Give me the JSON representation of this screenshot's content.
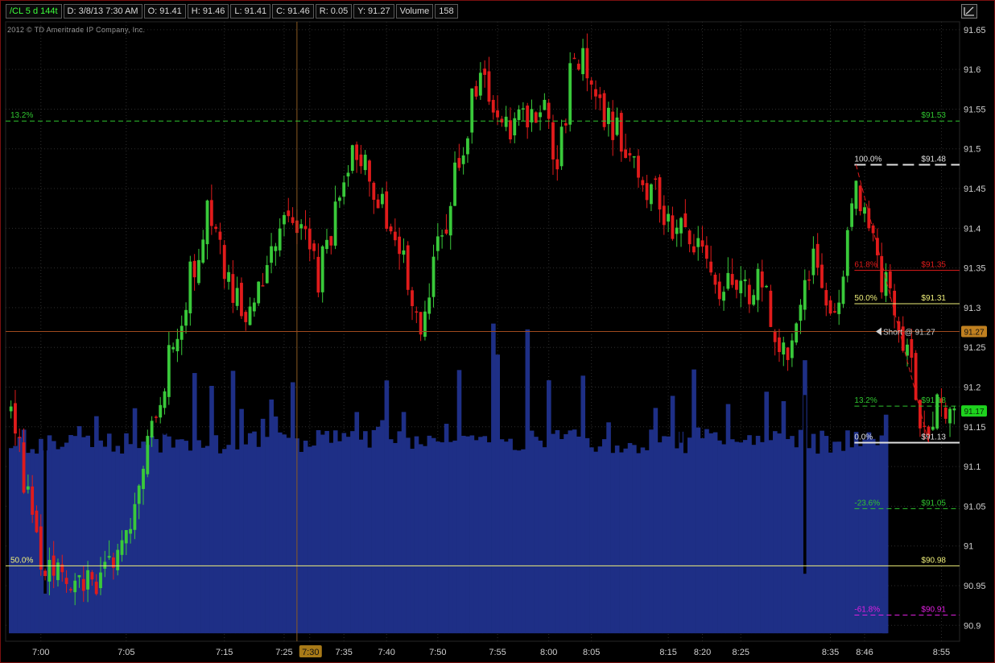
{
  "header": {
    "symbol": "/CL 5 d 144t",
    "date": "D: 3/8/13 7:30 AM",
    "open": "O: 91.41",
    "high": "H: 91.46",
    "low": "L: 91.41",
    "close": "C: 91.46",
    "range": "R: 0.05",
    "y": "Y: 91.27",
    "volume_label": "Volume",
    "volume_value": "158"
  },
  "copyright": "2012 © TD Ameritrade IP Company, Inc.",
  "icons": {
    "cursor_button": "crosshair-cursor-icon",
    "order_marker": "left-triangle-icon"
  },
  "colors": {
    "background": "#000000",
    "volume": "#1e2f86",
    "up_candle": "#39c93a",
    "down_candle": "#e01b1b",
    "grid": "#2e2e2e",
    "fib_white": "#e0e0e0",
    "fib_red": "#e01b1b",
    "fib_yellow": "#f0f07a",
    "fib_green": "#2fc42f",
    "fib_magenta": "#e020e0",
    "order_line": "#a04a1e",
    "price_tag_order": "#c08020",
    "price_tag_last": "#1ed21e"
  },
  "chart_data": {
    "type": "candlestick",
    "ylim": [
      90.88,
      91.66
    ],
    "ytick_labels": [
      "91.65",
      "91.6",
      "91.55",
      "91.5",
      "91.45",
      "91.4",
      "91.35",
      "91.3",
      "91.25",
      "91.2",
      "91.15",
      "91.1",
      "91.05",
      "91",
      "90.95",
      "90.9"
    ],
    "ytick_values": [
      91.65,
      91.6,
      91.55,
      91.5,
      91.45,
      91.4,
      91.35,
      91.3,
      91.25,
      91.2,
      91.15,
      91.1,
      91.05,
      91.0,
      90.95,
      90.9
    ],
    "xtick_labels": [
      "7:00",
      "7:05",
      "7:15",
      "7:25",
      "7:30",
      "7:35",
      "7:40",
      "7:50",
      "7:55",
      "8:00",
      "8:05",
      "8:15",
      "8:20",
      "8:25",
      "8:35",
      "8:46",
      "8:55"
    ],
    "xtick_index": [
      7,
      27,
      50,
      64,
      70,
      78,
      88,
      100,
      114,
      126,
      136,
      154,
      162,
      171,
      192,
      200,
      218
    ],
    "highlighted_xtick": "7:30",
    "bar_count": 222,
    "crosshair": {
      "index": 67,
      "price": 91.27
    },
    "candle_path": [
      [
        0,
        91.16
      ],
      [
        8,
        90.97
      ],
      [
        20,
        90.96
      ],
      [
        27,
        91.02
      ],
      [
        38,
        91.25
      ],
      [
        46,
        91.42
      ],
      [
        55,
        91.27
      ],
      [
        65,
        91.44
      ],
      [
        72,
        91.34
      ],
      [
        80,
        91.5
      ],
      [
        90,
        91.4
      ],
      [
        96,
        91.28
      ],
      [
        104,
        91.46
      ],
      [
        110,
        91.6
      ],
      [
        118,
        91.52
      ],
      [
        124,
        91.56
      ],
      [
        128,
        91.47
      ],
      [
        132,
        91.63
      ],
      [
        140,
        91.54
      ],
      [
        148,
        91.47
      ],
      [
        155,
        91.4
      ],
      [
        162,
        91.36
      ],
      [
        170,
        91.31
      ],
      [
        176,
        91.33
      ],
      [
        182,
        91.22
      ],
      [
        188,
        91.36
      ],
      [
        192,
        91.27
      ],
      [
        198,
        91.44
      ],
      [
        203,
        91.36
      ],
      [
        208,
        91.28
      ],
      [
        214,
        91.15
      ],
      [
        217,
        91.18
      ],
      [
        219,
        91.14
      ],
      [
        221,
        91.17
      ]
    ],
    "volume_values_relative": "base 0.55–0.72 with spikes (largest near 7:50, 8:00 and 8:46); drop-out bars near 7:02, 7:05 and 8:30",
    "fib_sets": [
      {
        "levels": [
          {
            "label": "13.2%",
            "price_label": "$91.53",
            "price": 91.535,
            "color": "green",
            "style": "dashed",
            "span": "full"
          },
          {
            "label": "50.0%",
            "price_label": "$90.98",
            "price": 90.975,
            "color": "yellow",
            "style": "solid",
            "span": "full"
          }
        ]
      },
      {
        "anchor_start": {
          "index": 198,
          "price": 91.48
        },
        "anchor_end": {
          "index": 215,
          "price": 91.13
        },
        "levels": [
          {
            "label": "100.0%",
            "price_label": "$91.48",
            "price": 91.48,
            "color": "white",
            "style": "dashed-thick"
          },
          {
            "label": "61.8%",
            "price_label": "$91.35",
            "price": 91.347,
            "color": "red",
            "style": "solid"
          },
          {
            "label": "50.0%",
            "price_label": "$91.31",
            "price": 91.305,
            "color": "yellow",
            "style": "solid"
          },
          {
            "label": "13.2%",
            "price_label": "$91.18",
            "price": 91.176,
            "color": "green",
            "style": "dashed"
          },
          {
            "label": "0.0%",
            "price_label": "$91.13",
            "price": 91.13,
            "color": "white",
            "style": "solid"
          },
          {
            "label": "-23.6%",
            "price_label": "$91.05",
            "price": 91.047,
            "color": "green",
            "style": "dashed"
          },
          {
            "label": "-61.8%",
            "price_label": "$90.91",
            "price": 90.913,
            "color": "magenta",
            "style": "dashed"
          }
        ]
      }
    ],
    "order": {
      "label": "Short @ 91.27",
      "price": 91.27,
      "tag": "91.27"
    },
    "last_price": {
      "price": 91.17,
      "tag": "91.17"
    }
  }
}
